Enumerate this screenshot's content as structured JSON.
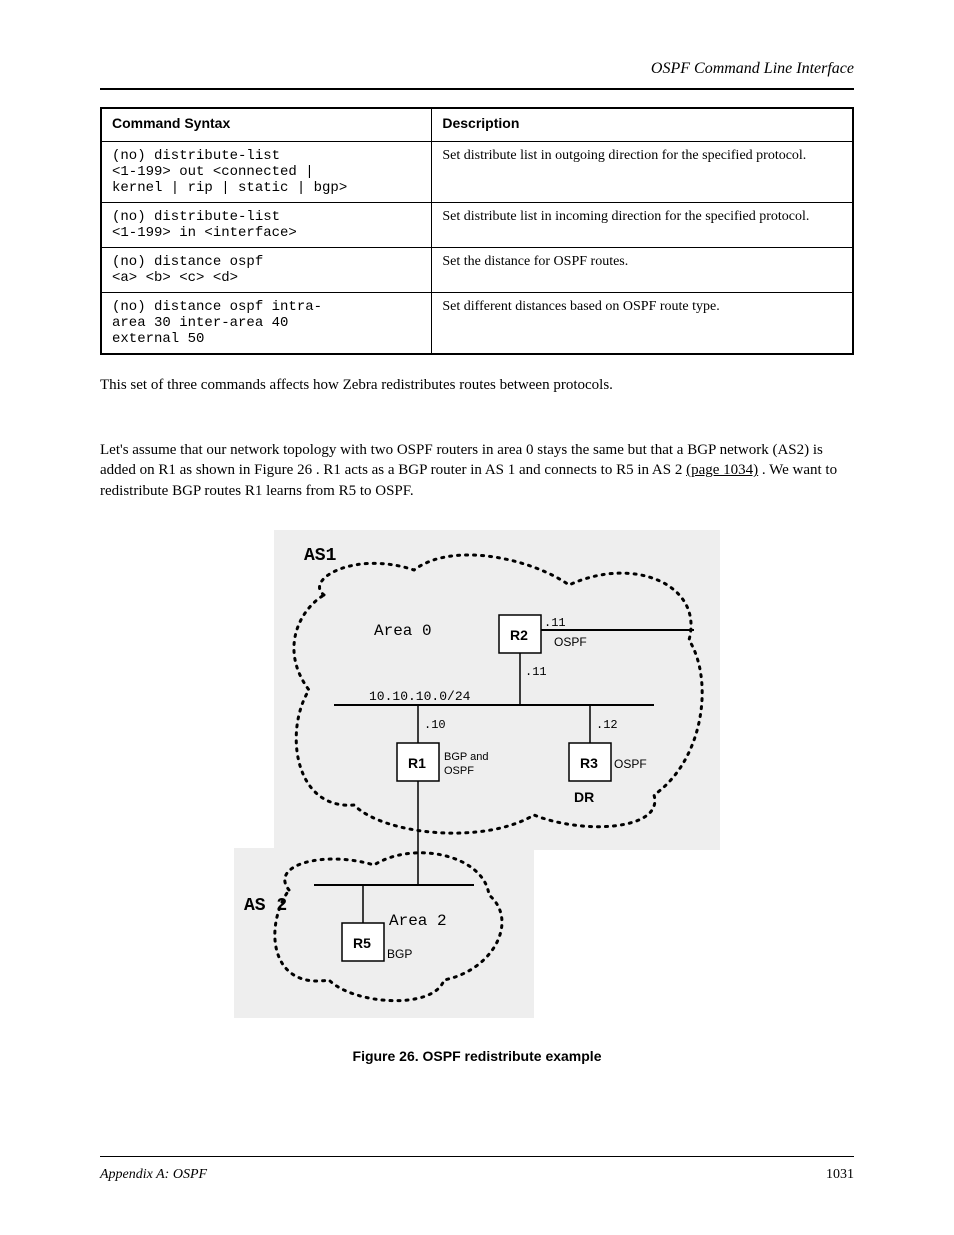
{
  "header": {
    "right": "OSPF Command Line Interface"
  },
  "table": {
    "headers": [
      "Command Syntax",
      "Description"
    ],
    "rows": [
      {
        "cmd": "(no) distribute-list\n<1-199> out <connected |\nkernel | rip | static | bgp>",
        "desc": "Set distribute list in outgoing direction for the specified protocol."
      },
      {
        "cmd": "(no) distribute-list\n<1-199> in <interface>",
        "desc": "Set distribute list in incoming direction for the specified protocol."
      },
      {
        "cmd": "(no) distance ospf\n<a> <b> <c> <d>",
        "desc": "Set the distance for OSPF routes."
      },
      {
        "cmd": "(no) distance ospf intra-\narea 30 inter-area 40\nexternal 50",
        "desc": "Set different distances based on OSPF route type."
      }
    ]
  },
  "paragraphs": {
    "p1": "This set of three commands affects how Zebra redistributes routes between protocols.",
    "p2a": "Let's assume that our network topology with two OSPF routers in area 0 stays the same but that a BGP network (AS2) is added on R1 as shown in ",
    "p2b": "Figure 26",
    "p2c": ". R1 acts as a BGP router in AS 1 and connects to R5 in AS 2 ",
    "p2d": "(page 1034)",
    "p2e": ". We want to redistribute BGP routes R1 learns from R5 to OSPF."
  },
  "diagram": {
    "as1": "AS1",
    "as2": "AS 2",
    "area0": "Area 0",
    "area2": "Area 2",
    "r1": "R1",
    "r2": "R2",
    "r3": "R3",
    "r5": "R5",
    "ospf": "OSPF",
    "bgp": "BGP",
    "bgp_ospf1": "BGP and",
    "bgp_ospf2": "OSPF",
    "dr": "DR",
    "net": "10.10.10.0/24",
    "a10": ".10",
    "a11": ".11",
    "a11b": ".11",
    "a12": ".12"
  },
  "caption": "Figure 26. OSPF redistribute example",
  "footer": {
    "left": "Appendix A: OSPF",
    "right": "1031"
  }
}
